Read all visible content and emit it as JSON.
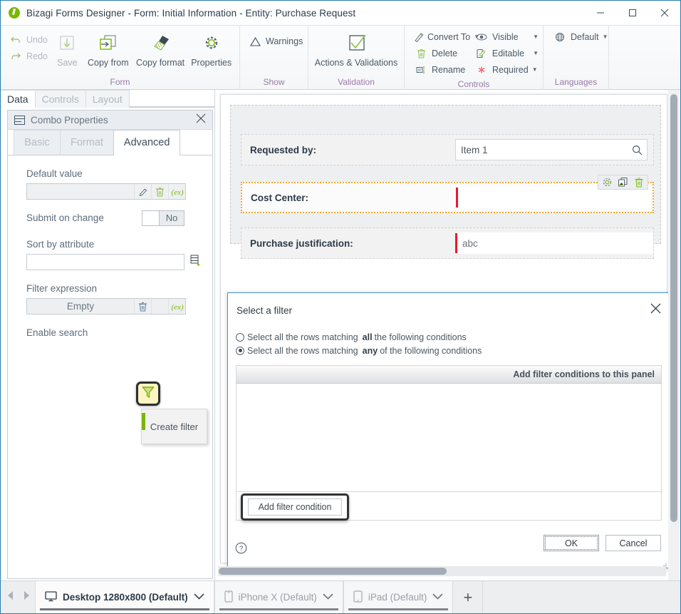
{
  "window": {
    "title": "Bizagi Forms Designer  - Form: Initial Information - Entity:  Purchase Request",
    "logo": "bizagi-logo",
    "minimize": "minimize-icon",
    "maximize": "maximize-icon",
    "close": "close-icon"
  },
  "ribbon": {
    "groups": [
      {
        "label": "Form",
        "quick": [
          {
            "label": "Undo",
            "icon": "undo-icon",
            "disabled": true
          },
          {
            "label": "Redo",
            "icon": "redo-icon",
            "disabled": true
          }
        ],
        "buttons": [
          {
            "label": "Save",
            "icon": "save-icon",
            "disabled": true
          },
          {
            "label": "Copy from",
            "icon": "copy-from-icon",
            "disabled": false
          },
          {
            "label": "Copy format",
            "icon": "copy-format-icon",
            "disabled": false
          },
          {
            "label": "Properties",
            "icon": "properties-gear-icon",
            "disabled": false
          }
        ]
      },
      {
        "label": "Show",
        "buttons": [
          {
            "label": "Warnings",
            "icon": "warning-triangle-icon"
          }
        ]
      },
      {
        "label": "Validation",
        "buttons": [
          {
            "label": "Actions & Validations",
            "icon": "checkbox-check-icon"
          }
        ]
      },
      {
        "label": "Controls",
        "items": [
          {
            "label": "Convert To",
            "icon": "convert-to-icon",
            "dropdown": true
          },
          {
            "label": "Delete",
            "icon": "trash-icon",
            "dropdown": false
          },
          {
            "label": "Rename",
            "icon": "rename-icon",
            "dropdown": false
          },
          {
            "label": "Visible",
            "icon": "eye-icon",
            "dropdown": true
          },
          {
            "label": "Editable",
            "icon": "editable-pencil-icon",
            "dropdown": true
          },
          {
            "label": "Required",
            "icon": "required-asterisk-icon",
            "dropdown": true
          }
        ]
      },
      {
        "label": "Languages",
        "items": [
          {
            "label": "Default",
            "icon": "globe-icon",
            "dropdown": true
          }
        ]
      }
    ]
  },
  "left_panel": {
    "tabs": [
      {
        "label": "Data",
        "active": true
      },
      {
        "label": "Controls",
        "active": false
      },
      {
        "label": "Layout",
        "active": false
      }
    ],
    "properties": {
      "header_title": "Combo Properties",
      "header_icon": "combo-icon",
      "close_icon": "close-icon",
      "sub_tabs": [
        {
          "label": "Basic",
          "active": false
        },
        {
          "label": "Format",
          "active": false
        },
        {
          "label": "Advanced",
          "active": true
        }
      ],
      "fields": {
        "default_value": {
          "label": "Default value",
          "value": "",
          "buttons": [
            "pencil-icon",
            "trash-icon",
            "expression-icon"
          ]
        },
        "submit_on_change": {
          "label": "Submit on change",
          "value": "No"
        },
        "sort_by_attribute": {
          "label": "Sort by attribute",
          "value": "",
          "button": "database-add-icon"
        },
        "filter_expression": {
          "label": "Filter expression",
          "value": "Empty",
          "buttons": [
            "trash-icon",
            "filter-funnel-icon",
            "expression-icon"
          ]
        },
        "enable_search": {
          "label": "Enable search"
        }
      },
      "tooltip": {
        "text": "Create filter"
      }
    }
  },
  "form_canvas": {
    "fields": [
      {
        "label": "Requested by:",
        "value": "Item 1",
        "type": "combo-search",
        "icon": "search-icon",
        "selected": false,
        "required": false
      },
      {
        "label": "Cost Center:",
        "value": "",
        "type": "combo",
        "selected": true,
        "required": true,
        "toolbar_icons": [
          "gear-icon",
          "duplicate-icon",
          "trash-icon"
        ]
      },
      {
        "label": "Purchase justification:",
        "value": "abc",
        "type": "text",
        "selected": false,
        "required": true
      }
    ]
  },
  "dialog": {
    "title": "Select a filter",
    "close_icon": "close-icon",
    "options": [
      {
        "prefix": "Select all the rows matching",
        "strong": "all",
        "suffix": "the following conditions",
        "selected": false
      },
      {
        "prefix": "Select all the rows matching",
        "strong": "any",
        "suffix": "of the following conditions",
        "selected": true
      }
    ],
    "panel_header": "Add filter conditions to this panel",
    "add_condition_label": "Add filter condition",
    "help_icon": "help-question-icon",
    "buttons": {
      "ok": "OK",
      "cancel": "Cancel"
    }
  },
  "bottom_bar": {
    "prev_icon": "prev-arrow-icon",
    "next_icon": "next-arrow-icon",
    "tabs": [
      {
        "label": "Desktop 1280x800 (Default)",
        "icon": "monitor-icon",
        "active": true
      },
      {
        "label": "iPhone X (Default)",
        "icon": "phone-icon",
        "active": false
      },
      {
        "label": "iPad (Default)",
        "icon": "tablet-icon",
        "active": false
      }
    ],
    "add_label": "+"
  },
  "colors": {
    "accent_green": "#7ab800",
    "group_label": "#9b7aa8",
    "highlight_yellow": "#fbf5c4",
    "required_red": "#e8192c",
    "selection_orange": "#f0a92c",
    "dialog_border_blue": "#4a90c8"
  }
}
